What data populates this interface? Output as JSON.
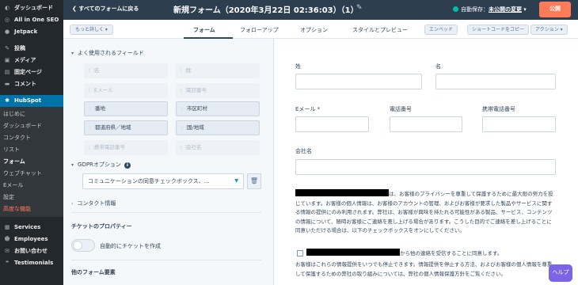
{
  "wp_sidebar": {
    "items": [
      {
        "icon": "gauge-icon",
        "glyph": "◐",
        "label": "ダッシュボード"
      },
      {
        "icon": "seo-icon",
        "glyph": "◎",
        "label": "All in One SEO"
      },
      {
        "icon": "jetpack-icon",
        "glyph": "●",
        "label": "Jetpack"
      }
    ],
    "items2": [
      {
        "icon": "pin-icon",
        "glyph": "✎",
        "label": "投稿"
      },
      {
        "icon": "media-icon",
        "glyph": "▣",
        "label": "メディア"
      },
      {
        "icon": "page-icon",
        "glyph": "▤",
        "label": "固定ページ"
      },
      {
        "icon": "comment-icon",
        "glyph": "▬",
        "label": "コメント"
      }
    ],
    "hubspot": {
      "icon": "hubspot-icon",
      "glyph": "✱",
      "label": "HubSpot"
    },
    "sub_items": [
      "はじめに",
      "ダッシュボード",
      "コンタクト",
      "リスト",
      "フォーム",
      "ウェブチャット",
      "Eメール",
      "設定",
      "高度な機能"
    ],
    "items3": [
      {
        "icon": "services-icon",
        "glyph": "▦",
        "label": "Services"
      },
      {
        "icon": "employees-icon",
        "glyph": "☻",
        "label": "Employees"
      },
      {
        "icon": "mail-icon",
        "glyph": "✉",
        "label": "お問い合わせ"
      },
      {
        "icon": "testimonials-icon",
        "glyph": "❝",
        "label": "Testimonials"
      }
    ]
  },
  "topbar": {
    "back_label": "すべてのフォームに戻る",
    "title": "新規フォーム（2020年3月22日 02:36:03）（1）",
    "autosave_label": "自動保存：",
    "autosave_link": "未公開の変更",
    "autosave_caret": "▾",
    "publish_label": "公開"
  },
  "subbar": {
    "ask_label": "もっと詳しく ▾",
    "tabs": [
      "フォーム",
      "フォローアップ",
      "オプション",
      "スタイルとプレビュー"
    ],
    "embed_label": "エンベッド",
    "copy_label": "ショートコードをコピー",
    "action_label": "アクション ▾"
  },
  "left_panel": {
    "common_fields_heading": "よく使用されるフィールド",
    "fields": [
      {
        "label": "名",
        "state": "dim"
      },
      {
        "label": "姓",
        "state": "dim"
      },
      {
        "label": "Eメール",
        "state": "dim"
      },
      {
        "label": "電話番号",
        "state": "dim"
      },
      {
        "label": "番地",
        "state": "on"
      },
      {
        "label": "市区町村",
        "state": "on"
      },
      {
        "label": "都道府県／地域",
        "state": "on"
      },
      {
        "label": "国/地域",
        "state": "on"
      },
      {
        "label": "携帯電話番号",
        "state": "dim"
      },
      {
        "label": "会社名",
        "state": "dim"
      }
    ],
    "gdpr_heading": "GDPRオプション",
    "gdpr_select_value": "コミュニケーションの同意チェックボックス、...",
    "contact_info_heading": "コンタクト情報",
    "ticket_heading": "チケットのプロパティー",
    "toggle_label": "自動的にチケットを作成",
    "other_heading": "他のフォーム要素"
  },
  "preview": {
    "labels": {
      "last_name": "姓",
      "first_name": "名",
      "email": "Eメール *",
      "phone": "電話番号",
      "mobile": "携帯電話番号",
      "company": "会社名"
    },
    "privacy_text_1": "は、お客様のプライバシーを尊重して保護するために最大限の努力を投じています。お客様の個人情報は、お客様のアカウントの管理、およびお客様が要求した製品やサービスに関する情報の提供にのみ利用されます。弊社は、お客様が興味を持たれる可能性がある製品、サービス、コンテンツの情報について、随時お客様にご連絡を差し上げる場合があります。こうした目的でご連絡を差し上げることに同意いただける場合は、以下のチェックボックスをオンにしてください。",
    "consent_text": "から他の連絡を受信することに同意します。",
    "privacy_text_2": "お客様はこれらの情報提供をいつでも停止できます。情報提供を停止する方法、およびお客様の個人情報を尊重して保護するための弊社の取り組みについては、弊社の個人情報保護方針をご覧ください。"
  },
  "help_label": "ヘルプ"
}
